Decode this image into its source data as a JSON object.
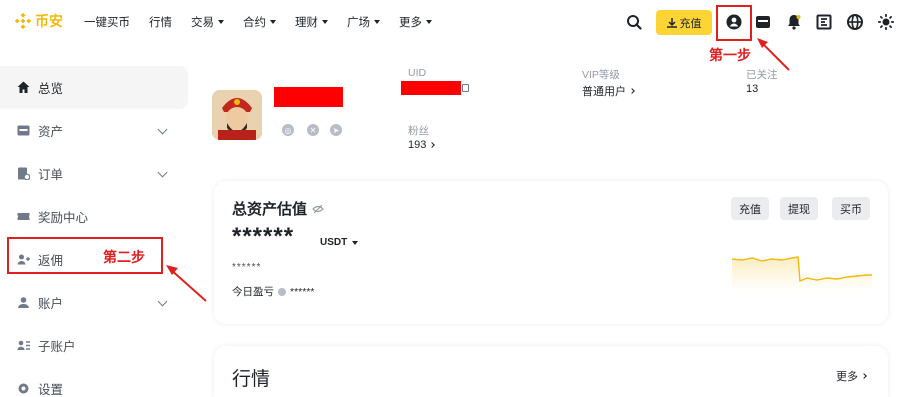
{
  "brand": {
    "name": "币安",
    "color": "#f0b90b"
  },
  "nav": [
    {
      "label": "一键买币",
      "dropdown": false
    },
    {
      "label": "行情",
      "dropdown": false
    },
    {
      "label": "交易",
      "dropdown": true
    },
    {
      "label": "合约",
      "dropdown": true
    },
    {
      "label": "理财",
      "dropdown": true
    },
    {
      "label": "广场",
      "dropdown": true
    },
    {
      "label": "更多",
      "dropdown": true
    }
  ],
  "header": {
    "deposit_label": "充值",
    "icons": [
      "search-icon",
      "user-icon",
      "wallet-icon",
      "bell-icon",
      "download-icon",
      "globe-icon",
      "theme-icon"
    ]
  },
  "annotations": {
    "step1": "第一步",
    "step2": "第二步",
    "color": "#e02020"
  },
  "sidebar": {
    "items": [
      {
        "label": "总览",
        "icon": "home-icon",
        "expandable": false,
        "active": true
      },
      {
        "label": "资产",
        "icon": "asset-icon",
        "expandable": true
      },
      {
        "label": "订单",
        "icon": "order-icon",
        "expandable": true
      },
      {
        "label": "奖励中心",
        "icon": "ticket-icon",
        "expandable": false
      },
      {
        "label": "返佣",
        "icon": "referral-icon",
        "expandable": false
      },
      {
        "label": "账户",
        "icon": "account-icon",
        "expandable": true
      },
      {
        "label": "子账户",
        "icon": "sub-account-icon",
        "expandable": false
      },
      {
        "label": "设置",
        "icon": "settings-icon",
        "expandable": false
      }
    ]
  },
  "profile": {
    "uid_label": "UID",
    "vip_label": "VIP等级",
    "vip_value": "普通用户",
    "following_label": "已关注",
    "following_value": "13",
    "followers_label": "粉丝",
    "followers_value": "193"
  },
  "assets": {
    "title": "总资产估值",
    "balance_masked": "******",
    "currency": "USDT",
    "sub_masked": "******",
    "pnl_label": "今日盈亏",
    "pnl_masked": "******",
    "buttons": [
      "充值",
      "提现",
      "买币"
    ],
    "spark_color": "#f0b90b"
  },
  "market": {
    "title": "行情",
    "more_label": "更多"
  }
}
